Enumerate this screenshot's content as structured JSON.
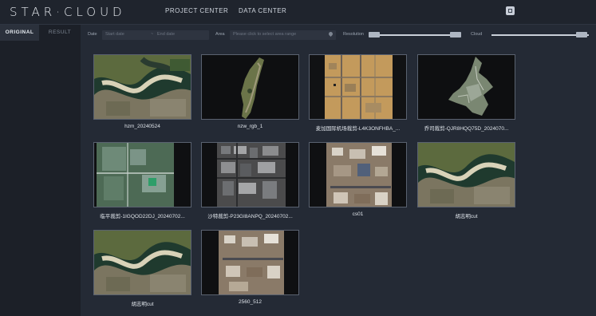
{
  "header": {
    "logo": "STAR·CLOUD",
    "nav": [
      "PROJECT CENTER",
      "DATA CENTER"
    ]
  },
  "sidebar": {
    "tabs": [
      {
        "label": "ORIGINAL",
        "active": true
      },
      {
        "label": "RESULT",
        "active": false
      }
    ]
  },
  "filters": {
    "date_label": "Date",
    "start_placeholder": "Start date",
    "range_sep": "~",
    "end_placeholder": "End date",
    "area_label": "Area",
    "area_placeholder": "Please click to select area range",
    "resolution_label": "Resolution",
    "cloud_label": "Cloud"
  },
  "images": [
    {
      "caption": "hzm_20240524",
      "icon": "river-city-thumbnail"
    },
    {
      "caption": "nzw_rgb_1",
      "icon": "strip-thumbnail"
    },
    {
      "caption": "麦加国际机场裁剪-L4K3ONFHBA_...",
      "icon": "airport-thumbnail"
    },
    {
      "caption": "乔司裁剪-QJR8HQQ75D_2024070...",
      "icon": "urban-shape-thumbnail"
    },
    {
      "caption": "临平裁剪-1IGQOD22DJ_20240702...",
      "icon": "suburb-thumbnail"
    },
    {
      "caption": "沙特裁剪-P23GI8ANPQ_20240702...",
      "icon": "dense-city-thumbnail"
    },
    {
      "caption": "cs01",
      "icon": "city-strip-thumbnail"
    },
    {
      "caption": "胡志明cut",
      "icon": "river-city-thumbnail"
    },
    {
      "caption": "胡志明cut",
      "icon": "river-city-thumbnail"
    },
    {
      "caption": "2560_512",
      "icon": "city-strip-thumbnail"
    }
  ]
}
